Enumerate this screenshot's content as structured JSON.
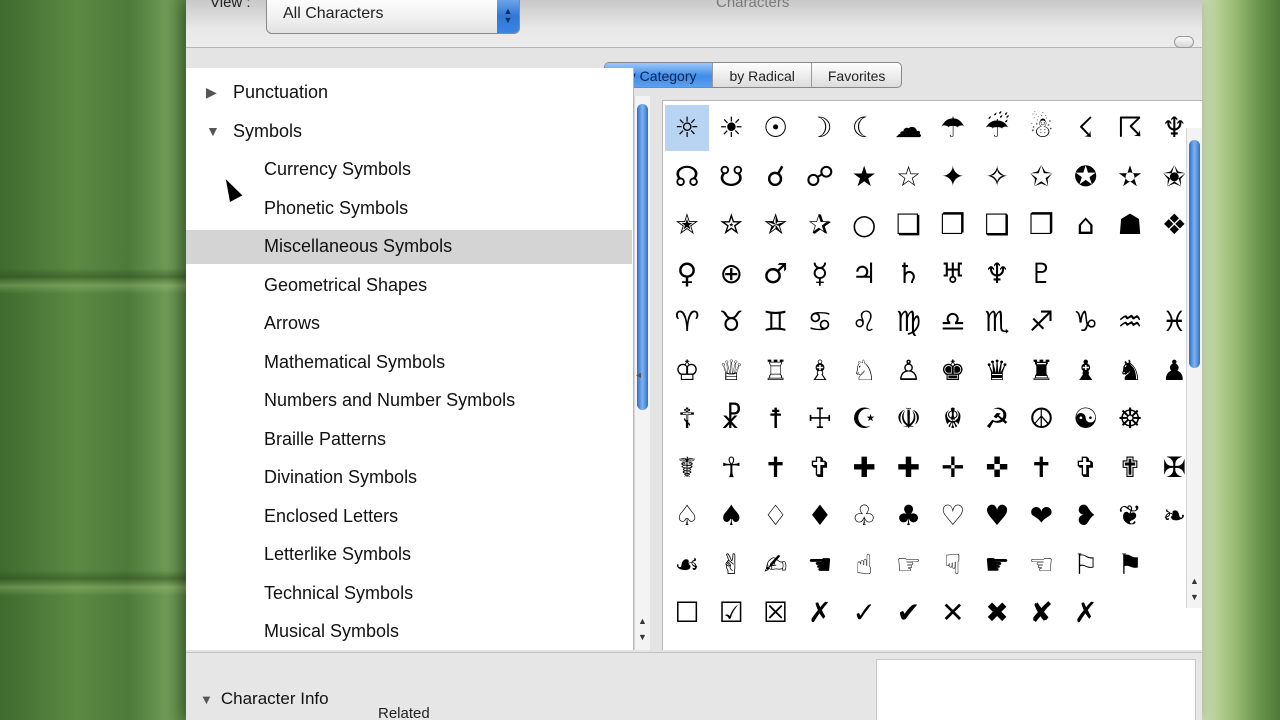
{
  "toolbar": {
    "view_label": "View :",
    "view_value": "All Characters",
    "window_title": "Characters"
  },
  "tabs": [
    {
      "label": "by Category",
      "active": true
    },
    {
      "label": "by Radical",
      "active": false
    },
    {
      "label": "Favorites",
      "active": false
    }
  ],
  "sidebar": {
    "items": [
      {
        "label": "Punctuation",
        "level": 0,
        "expanded": false
      },
      {
        "label": "Symbols",
        "level": 0,
        "expanded": true
      },
      {
        "label": "Currency Symbols",
        "level": 1
      },
      {
        "label": "Phonetic Symbols",
        "level": 1
      },
      {
        "label": "Miscellaneous Symbols",
        "level": 1,
        "selected": true
      },
      {
        "label": "Geometrical Shapes",
        "level": 1
      },
      {
        "label": "Arrows",
        "level": 1
      },
      {
        "label": "Mathematical Symbols",
        "level": 1
      },
      {
        "label": "Numbers and Number Symbols",
        "level": 1
      },
      {
        "label": "Braille Patterns",
        "level": 1
      },
      {
        "label": "Divination Symbols",
        "level": 1
      },
      {
        "label": "Enclosed Letters",
        "level": 1
      },
      {
        "label": "Letterlike Symbols",
        "level": 1
      },
      {
        "label": "Technical Symbols",
        "level": 1
      },
      {
        "label": "Musical Symbols",
        "level": 1
      }
    ]
  },
  "grid": {
    "rows": [
      [
        "☼",
        "☀",
        "☉",
        "☽",
        "☾",
        "☁",
        "☂",
        "☔",
        "☃",
        "☇",
        "☈",
        "♆"
      ],
      [
        "☊",
        "☋",
        "☌",
        "☍",
        "★",
        "☆",
        "✦",
        "✧",
        "✩",
        "✪",
        "✫",
        "✬"
      ],
      [
        "✭",
        "✮",
        "✯",
        "✰",
        "○",
        "❏",
        "❐",
        "❑",
        "❒",
        "⌂",
        "☗",
        "❖"
      ],
      [
        "♀",
        "⊕",
        "♂",
        "☿",
        "♃",
        "♄",
        "♅",
        "♆",
        "♇"
      ],
      [
        "♈",
        "♉",
        "♊",
        "♋",
        "♌",
        "♍",
        "♎",
        "♏",
        "♐",
        "♑",
        "♒",
        "♓"
      ],
      [
        "♔",
        "♕",
        "♖",
        "♗",
        "♘",
        "♙",
        "♚",
        "♛",
        "♜",
        "♝",
        "♞",
        "♟"
      ],
      [
        "☦",
        "☧",
        "☨",
        "☩",
        "☪",
        "☫",
        "☬",
        "☭",
        "☮",
        "☯",
        "☸"
      ],
      [
        "☤",
        "☥",
        "✝",
        "✞",
        "✚",
        "✚",
        "✛",
        "✜",
        "✝",
        "✞",
        "✟",
        "✠"
      ],
      [
        "♤",
        "♠",
        "♢",
        "♦",
        "♧",
        "♣",
        "♡",
        "♥",
        "❤",
        "❥",
        "❦",
        "❧"
      ],
      [
        "☙",
        "✌",
        "✍",
        "☚",
        "☝",
        "☞",
        "☟",
        "☛",
        "☜",
        "⚐",
        "⚑"
      ],
      [
        "☐",
        "☑",
        "☒",
        "✗",
        "✓",
        "✔",
        "✕",
        "✖",
        "✘",
        "✗"
      ]
    ]
  },
  "bottom": {
    "char_info_label": "Character Info",
    "related_label": "Related"
  }
}
